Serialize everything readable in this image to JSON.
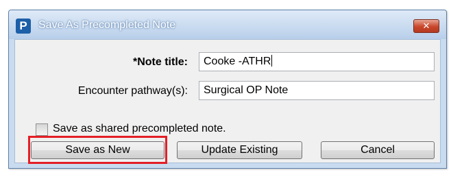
{
  "dialog": {
    "icon_letter": "P",
    "title": "Save As Precompleted Note",
    "close_symbol": "✕"
  },
  "form": {
    "note_title_label": "*Note title:",
    "note_title_value": "Cooke -ATHR",
    "pathway_label": "Encounter pathway(s):",
    "pathway_value": "Surgical OP Note",
    "shared_checkbox_label": "Save as shared precompleted note.",
    "shared_checked": false
  },
  "buttons": {
    "save_new": "Save as New",
    "update_existing": "Update Existing",
    "cancel": "Cancel"
  },
  "colors": {
    "highlight": "#e41e26",
    "title_bar": "#c9dbef",
    "close_button": "#c8462b"
  }
}
